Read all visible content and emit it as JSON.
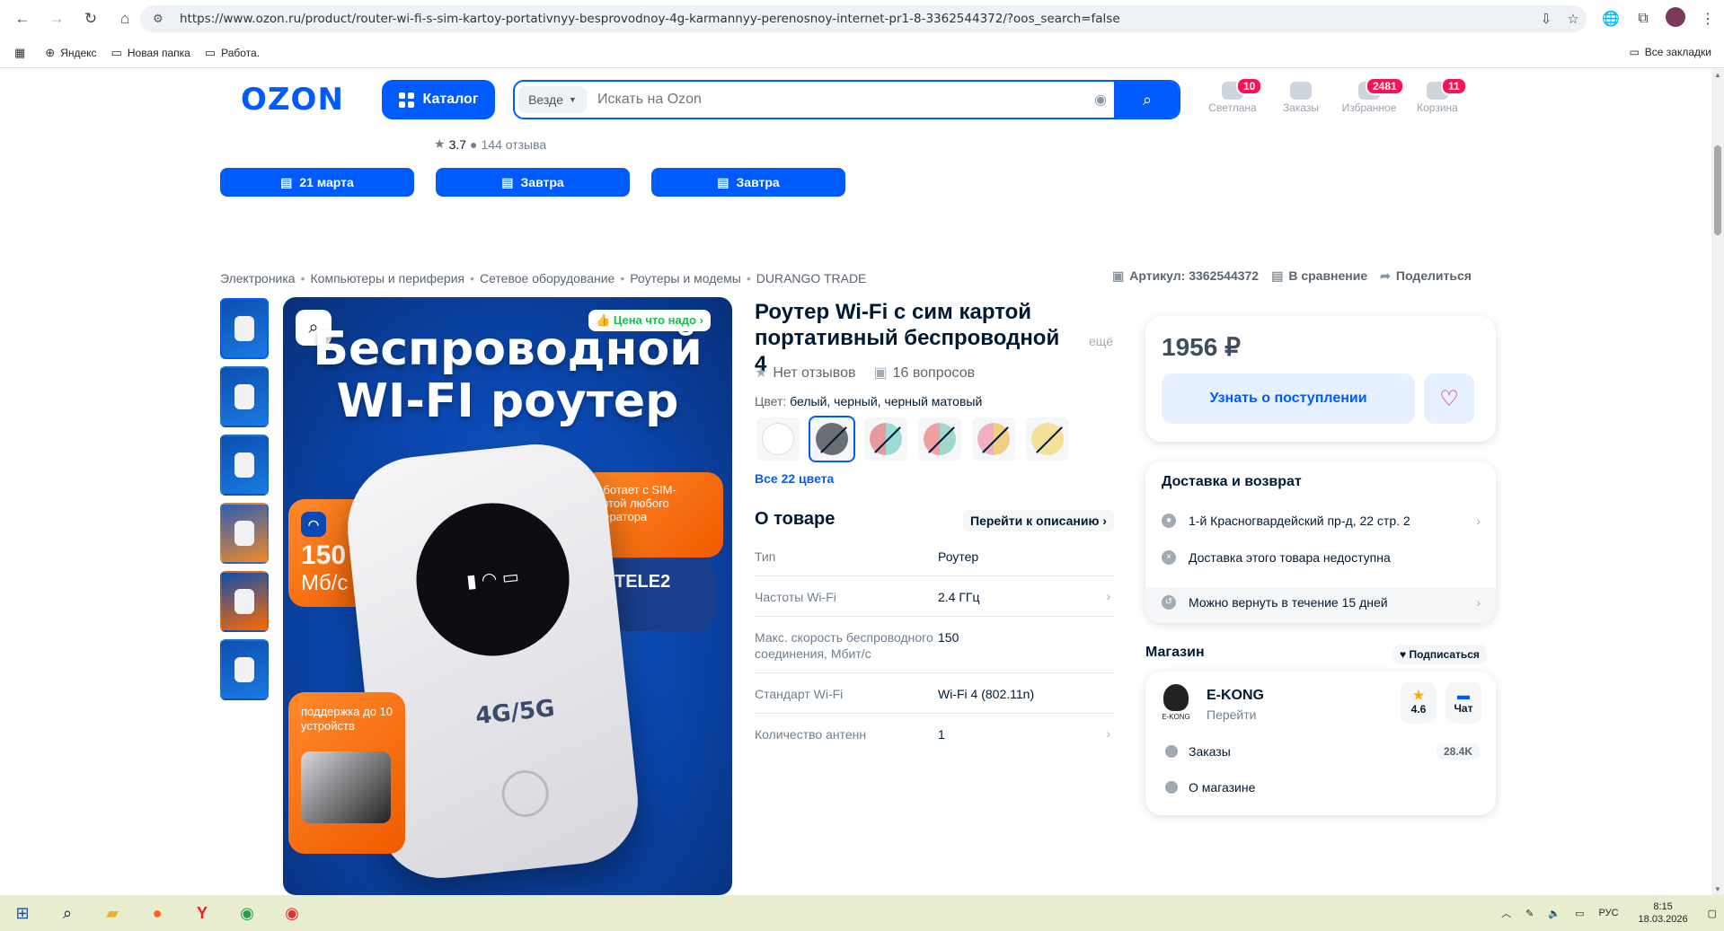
{
  "browser": {
    "url": "https://www.ozon.ru/product/router-wi-fi-s-sim-kartoy-portativnyy-besprovodnoy-4g-karmannyy-perenosnoy-internet-pr1-8-3362544372/?oos_search=false",
    "bookmarks": [
      "Яндекс",
      "Новая папка",
      "Работа."
    ],
    "all_bookmarks": "Все закладки"
  },
  "header": {
    "logo": "OZON",
    "catalog": "Каталог",
    "search_scope": "Везде",
    "search_placeholder": "Искать на Ozon",
    "icons": [
      {
        "label": "Светлана",
        "badge": "10"
      },
      {
        "label": "Заказы",
        "badge": ""
      },
      {
        "label": "Избранное",
        "badge": "2481"
      },
      {
        "label": "Корзина",
        "badge": "11"
      }
    ]
  },
  "prev_item": {
    "rating": "3.7",
    "reviews": "144 отзыва"
  },
  "delivery_buttons": [
    "21 марта",
    "Завтра",
    "Завтра"
  ],
  "breadcrumb": [
    "Электроника",
    "Компьютеры и периферия",
    "Сетевое оборудование",
    "Роутеры и модемы",
    "DURANGO TRADE"
  ],
  "meta": {
    "article": "Артикул: 3362544372",
    "compare": "В сравнение",
    "share": "Поделиться"
  },
  "image": {
    "badge": "Цена что надо",
    "line1": "Беспроводной",
    "line2": "WI-FI роутер",
    "speed_num": "150",
    "speed_unit": "Мб/с",
    "sim_text": "работает с SIM-картой любого оператора",
    "operator": "TELE2",
    "devices_text": "поддержка до 10 устройств",
    "device_label": "4G/5G"
  },
  "product": {
    "title": "Роутер Wi-Fi с сим картой портативный беспроводной 4",
    "more": "ещё",
    "reviews": "Нет отзывов",
    "questions": "16 вопросов",
    "color_label": "Цвет:",
    "color_value": "белый, черный, черный матовый",
    "swatch_colors": [
      "#ffffff",
      "#6b6f75",
      "#e8a0a0",
      "#f0a0a0",
      "#f0b0c0",
      "#f5e09a"
    ],
    "all_colors": "Все 22 цвета",
    "about": "О товаре",
    "goto_desc": "Перейти к описанию",
    "specs": [
      {
        "k": "Тип",
        "v": "Роутер"
      },
      {
        "k": "Частоты Wi-Fi",
        "v": "2.4 ГГц"
      },
      {
        "k": "Макс. скорость беспроводного соединения, Мбит/с",
        "v": "150"
      },
      {
        "k": "Стандарт Wi-Fi",
        "v": "Wi-Fi 4 (802.11n)"
      },
      {
        "k": "Количество антенн",
        "v": "1"
      }
    ]
  },
  "buy": {
    "price": "1956 ₽",
    "notify": "Узнать о поступлении"
  },
  "delivery": {
    "title": "Доставка и возврат",
    "address": "1-й Красногвардейский пр-д, 22 стр. 2",
    "unavailable": "Доставка этого товара недоступна",
    "return": "Можно вернуть в течение 15 дней"
  },
  "shop": {
    "heading": "Магазин",
    "subscribe": "Подписаться",
    "name": "E-KONG",
    "logo_text": "E-KONG",
    "go": "Перейти",
    "rating": "4.6",
    "chat": "Чат",
    "orders": "Заказы",
    "orders_count": "28.4K",
    "about": "О магазине"
  },
  "taskbar": {
    "lang": "РУС",
    "time": "8:15",
    "date": "18.03.2026"
  }
}
